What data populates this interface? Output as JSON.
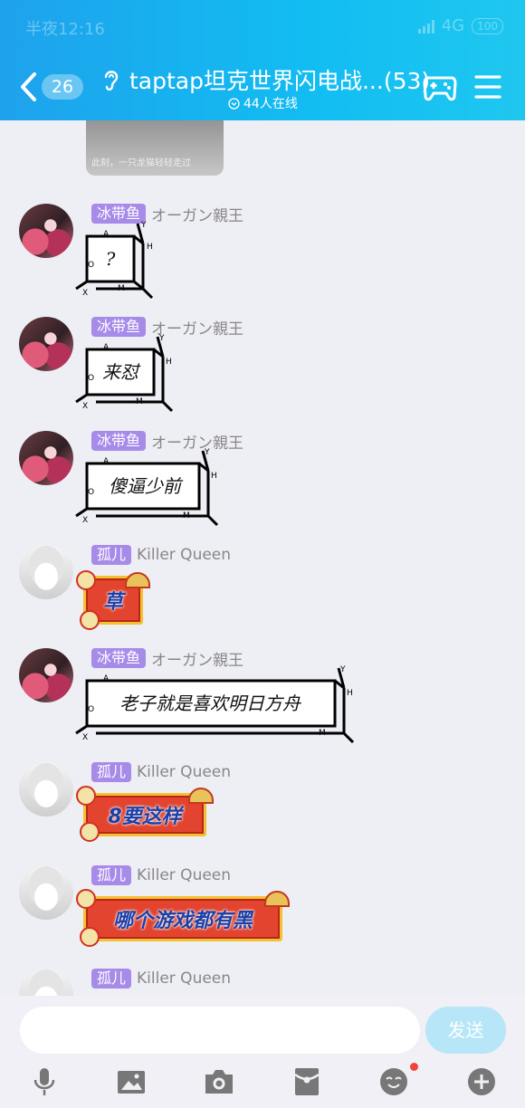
{
  "status_bar": {
    "time": "半夜12:16",
    "network": "4G",
    "battery": "100"
  },
  "header": {
    "unread_count": "26",
    "title": "taptap坦克世界闪电战...(53)",
    "online": "44人在线"
  },
  "previous_image_caption": "此刻，一只龙猫轻轻走过",
  "messages": [
    {
      "tag": "冰带鱼",
      "nick": "オーガン親王",
      "text": "?"
    },
    {
      "tag": "冰带鱼",
      "nick": "オーガン親王",
      "text": "来怼"
    },
    {
      "tag": "冰带鱼",
      "nick": "オーガン親王",
      "text": "傻逼少前"
    },
    {
      "tag": "孤儿",
      "nick": "Killer Queen",
      "text": "草"
    },
    {
      "tag": "冰带鱼",
      "nick": "オーガン親王",
      "text": "老子就是喜欢明日方舟"
    },
    {
      "tag": "孤儿",
      "nick": "Killer Queen",
      "text": "8要这样"
    },
    {
      "tag": "孤儿",
      "nick": "Killer Queen",
      "text": "哪个游戏都有黑"
    },
    {
      "tag": "孤儿",
      "nick": "Killer Queen",
      "text": ""
    }
  ],
  "box_labels": {
    "a": "A",
    "y": "Y",
    "h": "H",
    "o": "O",
    "x": "X",
    "m": "M"
  },
  "composer": {
    "placeholder": "",
    "send_label": "发送"
  },
  "toolbar_icons": [
    "microphone-icon",
    "image-icon",
    "camera-icon",
    "red-packet-icon",
    "emoji-icon",
    "plus-icon"
  ],
  "colors": {
    "header_start": "#1ea2ec",
    "header_end": "#1fc7ef",
    "tag_bg": "#a78be8",
    "send_bg": "#b6e6f8",
    "background": "#eeeef5"
  }
}
